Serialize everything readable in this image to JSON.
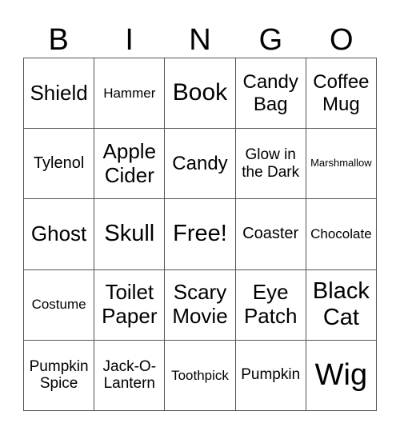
{
  "header": [
    "B",
    "I",
    "N",
    "G",
    "O"
  ],
  "cells": [
    {
      "text": "Shield"
    },
    {
      "text": "Hammer"
    },
    {
      "text": "Book"
    },
    {
      "text": "Candy Bag"
    },
    {
      "text": "Coffee Mug"
    },
    {
      "text": "Tylenol"
    },
    {
      "text": "Apple Cider"
    },
    {
      "text": "Candy"
    },
    {
      "text": "Glow in the Dark"
    },
    {
      "text": "Marshmallow"
    },
    {
      "text": "Ghost"
    },
    {
      "text": "Skull"
    },
    {
      "text": "Free!"
    },
    {
      "text": "Coaster"
    },
    {
      "text": "Chocolate"
    },
    {
      "text": "Costume"
    },
    {
      "text": "Toilet Paper"
    },
    {
      "text": "Scary Movie"
    },
    {
      "text": "Eye Patch"
    },
    {
      "text": "Black Cat"
    },
    {
      "text": "Pumpkin Spice"
    },
    {
      "text": "Jack-O-Lantern"
    },
    {
      "text": "Toothpick"
    },
    {
      "text": "Pumpkin"
    },
    {
      "text": "Wig"
    }
  ]
}
